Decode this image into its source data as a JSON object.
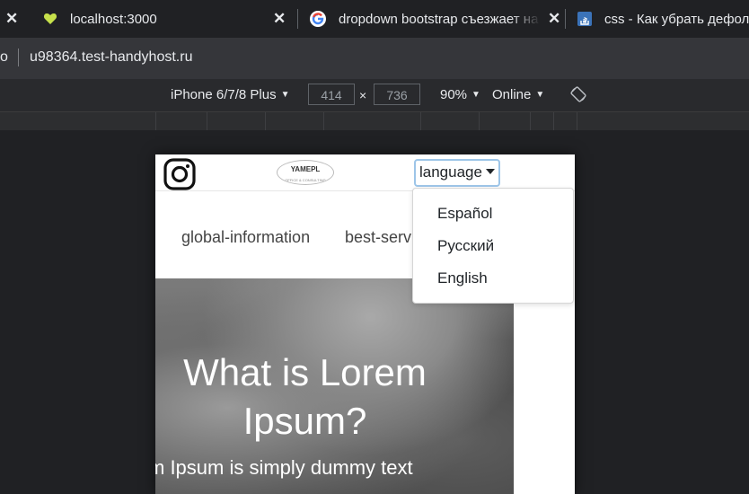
{
  "tabs": [
    {
      "label": "localhost:3000"
    },
    {
      "label": "dropdown bootstrap съезжает на"
    },
    {
      "label": "css - Как убрать дефолт"
    }
  ],
  "address": {
    "fragment": "o",
    "host": "u98364.test-handyhost.ru"
  },
  "device_toolbar": {
    "device": "iPhone 6/7/8 Plus",
    "width": "414",
    "times": "×",
    "height": "736",
    "zoom": "90%",
    "throttle": "Online"
  },
  "page": {
    "logo_text": "YAMEPL",
    "logo_subtext": "OFFICE & CONSULTING",
    "language_button": "language",
    "nav": [
      "global-information",
      "best-servi"
    ],
    "hero_title_line1": "What is Lorem",
    "hero_title_line2": "Ipsum?",
    "hero_text": "m Ipsum is simply dummy text"
  },
  "dropdown": {
    "options": [
      "Español",
      "Русский",
      "English"
    ]
  },
  "colors": {
    "focus_ring": "#9dc5e8",
    "tab_bg": "#202124",
    "address_bg": "#35363a"
  }
}
